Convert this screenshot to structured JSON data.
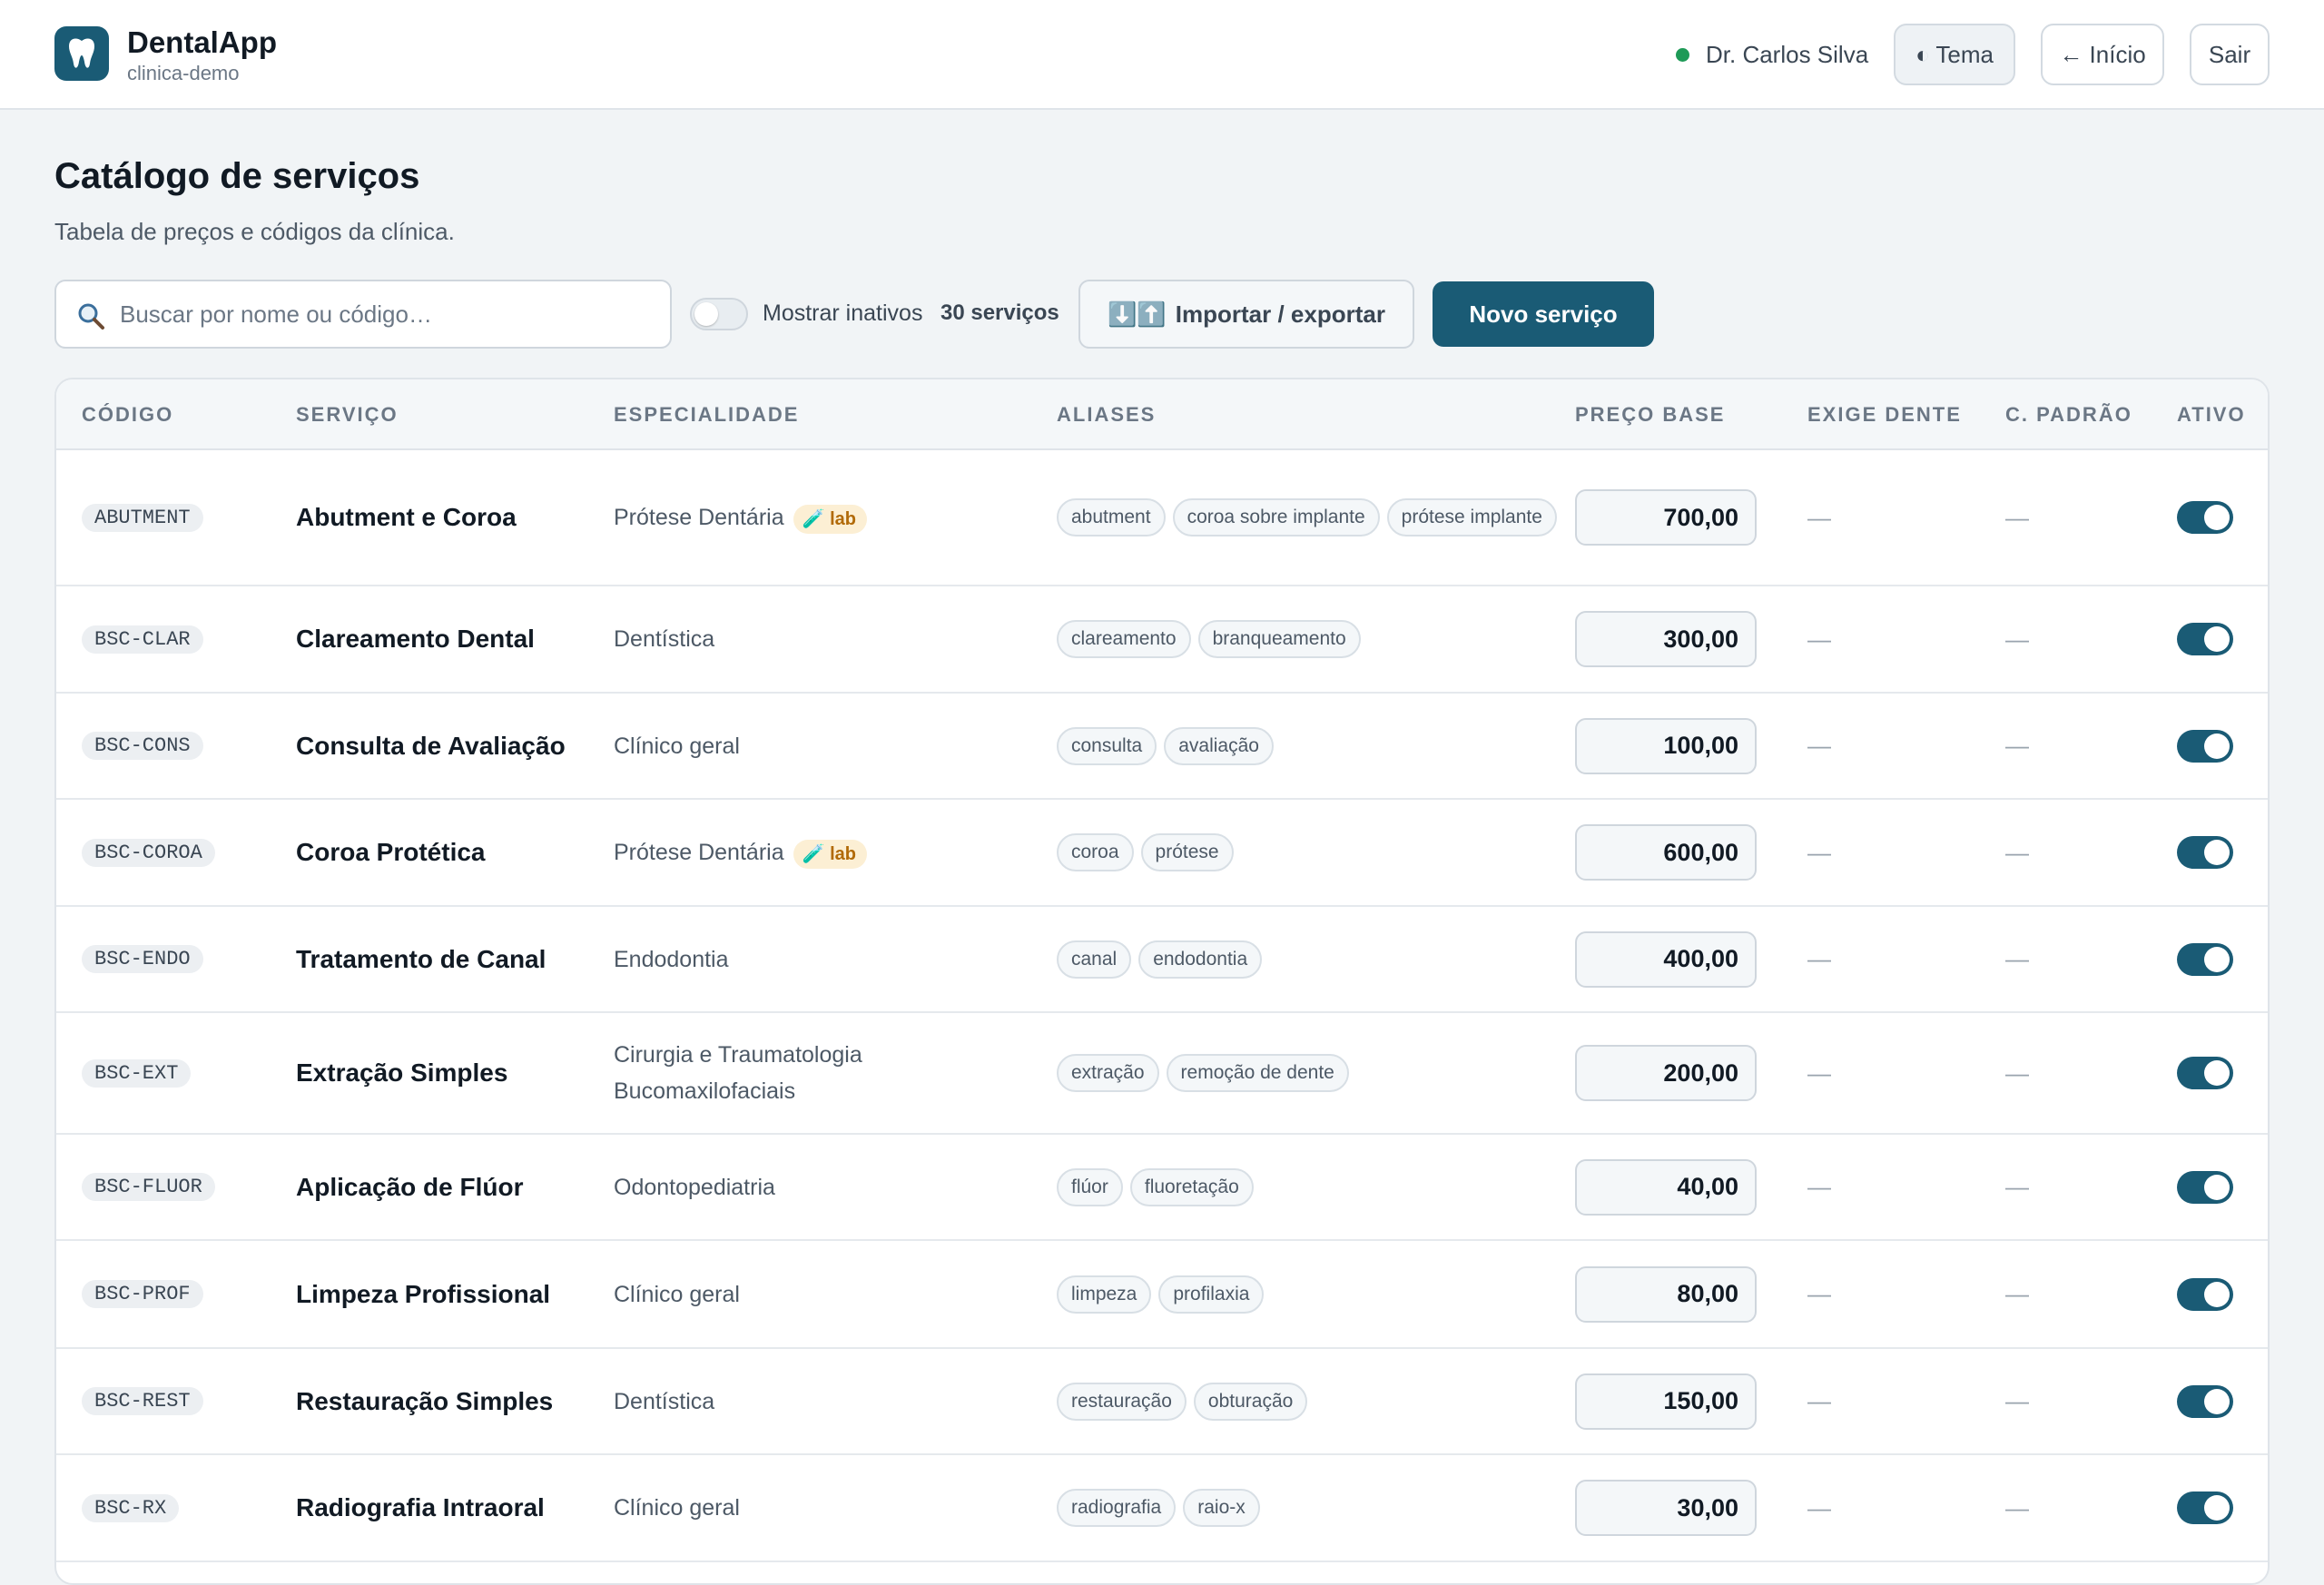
{
  "header": {
    "app_name": "DentalApp",
    "tenant": "clinica-demo",
    "user": "Dr. Carlos Silva",
    "theme_label": "◐ Tema",
    "home_label": "← Início",
    "logout_label": "Sair",
    "status_color": "#1e9a57"
  },
  "page": {
    "title": "Catálogo de serviços",
    "subtitle": "Tabela de preços e códigos da clínica."
  },
  "toolbar": {
    "search_placeholder": "Buscar por nome ou código…",
    "search_value": "",
    "show_inactive_label": "Mostrar inativos",
    "show_inactive_checked": false,
    "count": "30 serviços",
    "import_export_icon": "⬇️⬆️",
    "import_export_label": "Importar / exportar",
    "new_service_label": " Novo serviço"
  },
  "columns": [
    "CÓDIGO",
    "SERVIÇO",
    "ESPECIALIDADE",
    "ALIASES",
    "PREÇO BASE",
    "EXIGE DENTE",
    "C. PADRÃO",
    "ATIVO"
  ],
  "services": [
    {
      "code": "ABUTMENT",
      "name": "Abutment e Coroa",
      "specialty": "Prótese Dentária",
      "lab": true,
      "aliases": [
        "abutment",
        "coroa sobre implante",
        "prótese implante"
      ],
      "price": "700,00",
      "requires_tooth": "—",
      "standard": "—",
      "active": true
    },
    {
      "code": "BSC-CLAR",
      "name": "Clareamento Dental",
      "specialty": "Dentística",
      "lab": false,
      "aliases": [
        "clareamento",
        "branqueamento"
      ],
      "price": "300,00",
      "requires_tooth": "—",
      "standard": "—",
      "active": true
    },
    {
      "code": "BSC-CONS",
      "name": "Consulta de Avaliação",
      "specialty": "Clínico geral",
      "lab": false,
      "aliases": [
        "consulta",
        "avaliação"
      ],
      "price": "100,00",
      "requires_tooth": "—",
      "standard": "—",
      "active": true
    },
    {
      "code": "BSC-COROA",
      "name": "Coroa Protética",
      "specialty": "Prótese Dentária",
      "lab": true,
      "aliases": [
        "coroa",
        "prótese"
      ],
      "price": "600,00",
      "requires_tooth": "—",
      "standard": "—",
      "active": true
    },
    {
      "code": "BSC-ENDO",
      "name": "Tratamento de Canal",
      "specialty": "Endodontia",
      "lab": false,
      "aliases": [
        "canal",
        "endodontia"
      ],
      "price": "400,00",
      "requires_tooth": "—",
      "standard": "—",
      "active": true
    },
    {
      "code": "BSC-EXT",
      "name": "Extração Simples",
      "specialty": "Cirurgia e Traumatologia Bucomaxilofaciais",
      "lab": false,
      "aliases": [
        "extração",
        "remoção de dente"
      ],
      "price": "200,00",
      "requires_tooth": "—",
      "standard": "—",
      "active": true
    },
    {
      "code": "BSC-FLUOR",
      "name": "Aplicação de Flúor",
      "specialty": "Odontopediatria",
      "lab": false,
      "aliases": [
        "flúor",
        "fluoretação"
      ],
      "price": "40,00",
      "requires_tooth": "—",
      "standard": "—",
      "active": true
    },
    {
      "code": "BSC-PROF",
      "name": "Limpeza Profissional",
      "specialty": "Clínico geral",
      "lab": false,
      "aliases": [
        "limpeza",
        "profilaxia"
      ],
      "price": "80,00",
      "requires_tooth": "—",
      "standard": "—",
      "active": true
    },
    {
      "code": "BSC-REST",
      "name": "Restauração Simples",
      "specialty": "Dentística",
      "lab": false,
      "aliases": [
        "restauração",
        "obturação"
      ],
      "price": "150,00",
      "requires_tooth": "—",
      "standard": "—",
      "active": true
    },
    {
      "code": "BSC-RX",
      "name": "Radiografia Intraoral",
      "specialty": "Clínico geral",
      "lab": false,
      "aliases": [
        "radiografia",
        "raio-x"
      ],
      "price": "30,00",
      "requires_tooth": "—",
      "standard": "—",
      "active": true
    }
  ],
  "lab_badge": {
    "icon": "test-tube-icon",
    "label": "lab"
  },
  "colors": {
    "primary": "#1a5b75",
    "lab_bg": "#fcefd4",
    "lab_text": "#b16a08",
    "bg": "#f1f4f6"
  }
}
